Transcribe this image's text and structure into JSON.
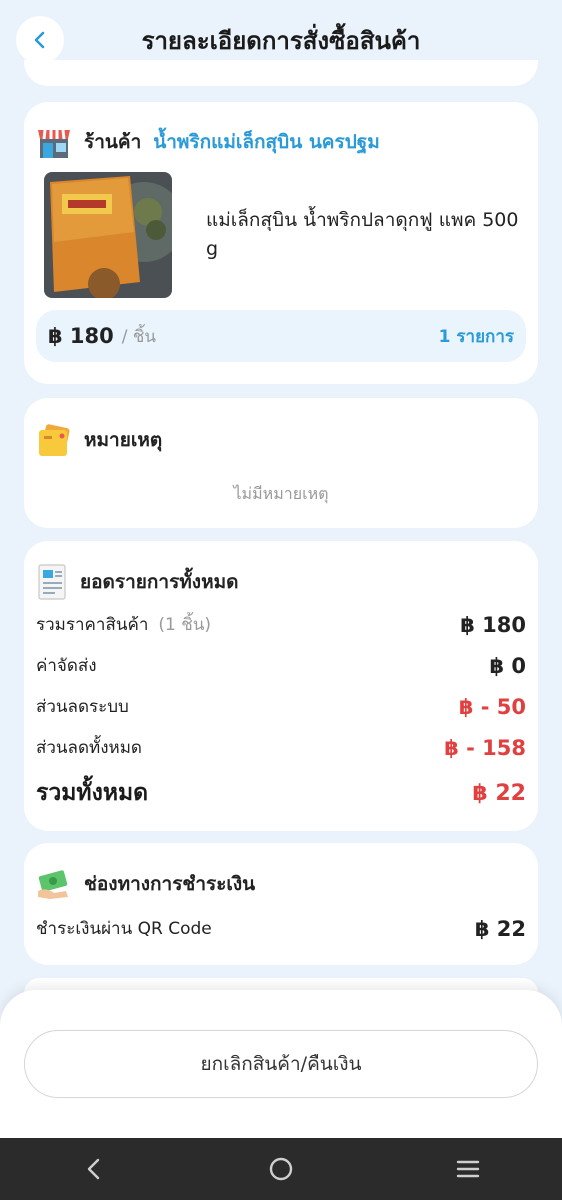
{
  "header": {
    "title": "รายละเอียดการสั่งซื้อสินค้า"
  },
  "shop": {
    "label": "ร้านค้า",
    "name": "น้ำพริกแม่เล็กสุบิน นครปฐม",
    "product_name": "แม่เล็กสุบิน น้ำพริกปลาดุกฟู แพค 500 g",
    "price": "฿ 180",
    "unit": "/ ชิ้น",
    "item_count": "1 รายการ"
  },
  "note": {
    "title": "หมายเหตุ",
    "empty_text": "ไม่มีหมายเหตุ"
  },
  "summary": {
    "title": "ยอดรายการทั้งหมด",
    "rows": [
      {
        "label": "รวมราคาสินค้า",
        "sub": "(1 ชิ้น)",
        "value": "฿ 180"
      },
      {
        "label": "ค่าจัดส่ง",
        "sub": "",
        "value": "฿ 0"
      },
      {
        "label": "ส่วนลดระบบ",
        "sub": "",
        "value": "฿ - 50"
      },
      {
        "label": "ส่วนลดทั้งหมด",
        "sub": "",
        "value": "฿ - 158"
      }
    ],
    "total_label": "รวมทั้งหมด",
    "total_value": "฿ 22"
  },
  "payment": {
    "title": "ช่องทางการชำระเงิน",
    "method": "ชำระเงินผ่าน QR Code",
    "amount": "฿ 22"
  },
  "actions": {
    "cancel_label": "ยกเลิกสินค้า/คืนเงิน"
  },
  "colors": {
    "accent": "#2a9bd8",
    "discount": "#e04040",
    "background": "#eaf2fb"
  },
  "icons": [
    "chevron-left-icon",
    "shop-icon",
    "note-icon",
    "receipt-icon",
    "money-icon",
    "nav-back-icon",
    "nav-home-icon",
    "nav-menu-icon"
  ]
}
